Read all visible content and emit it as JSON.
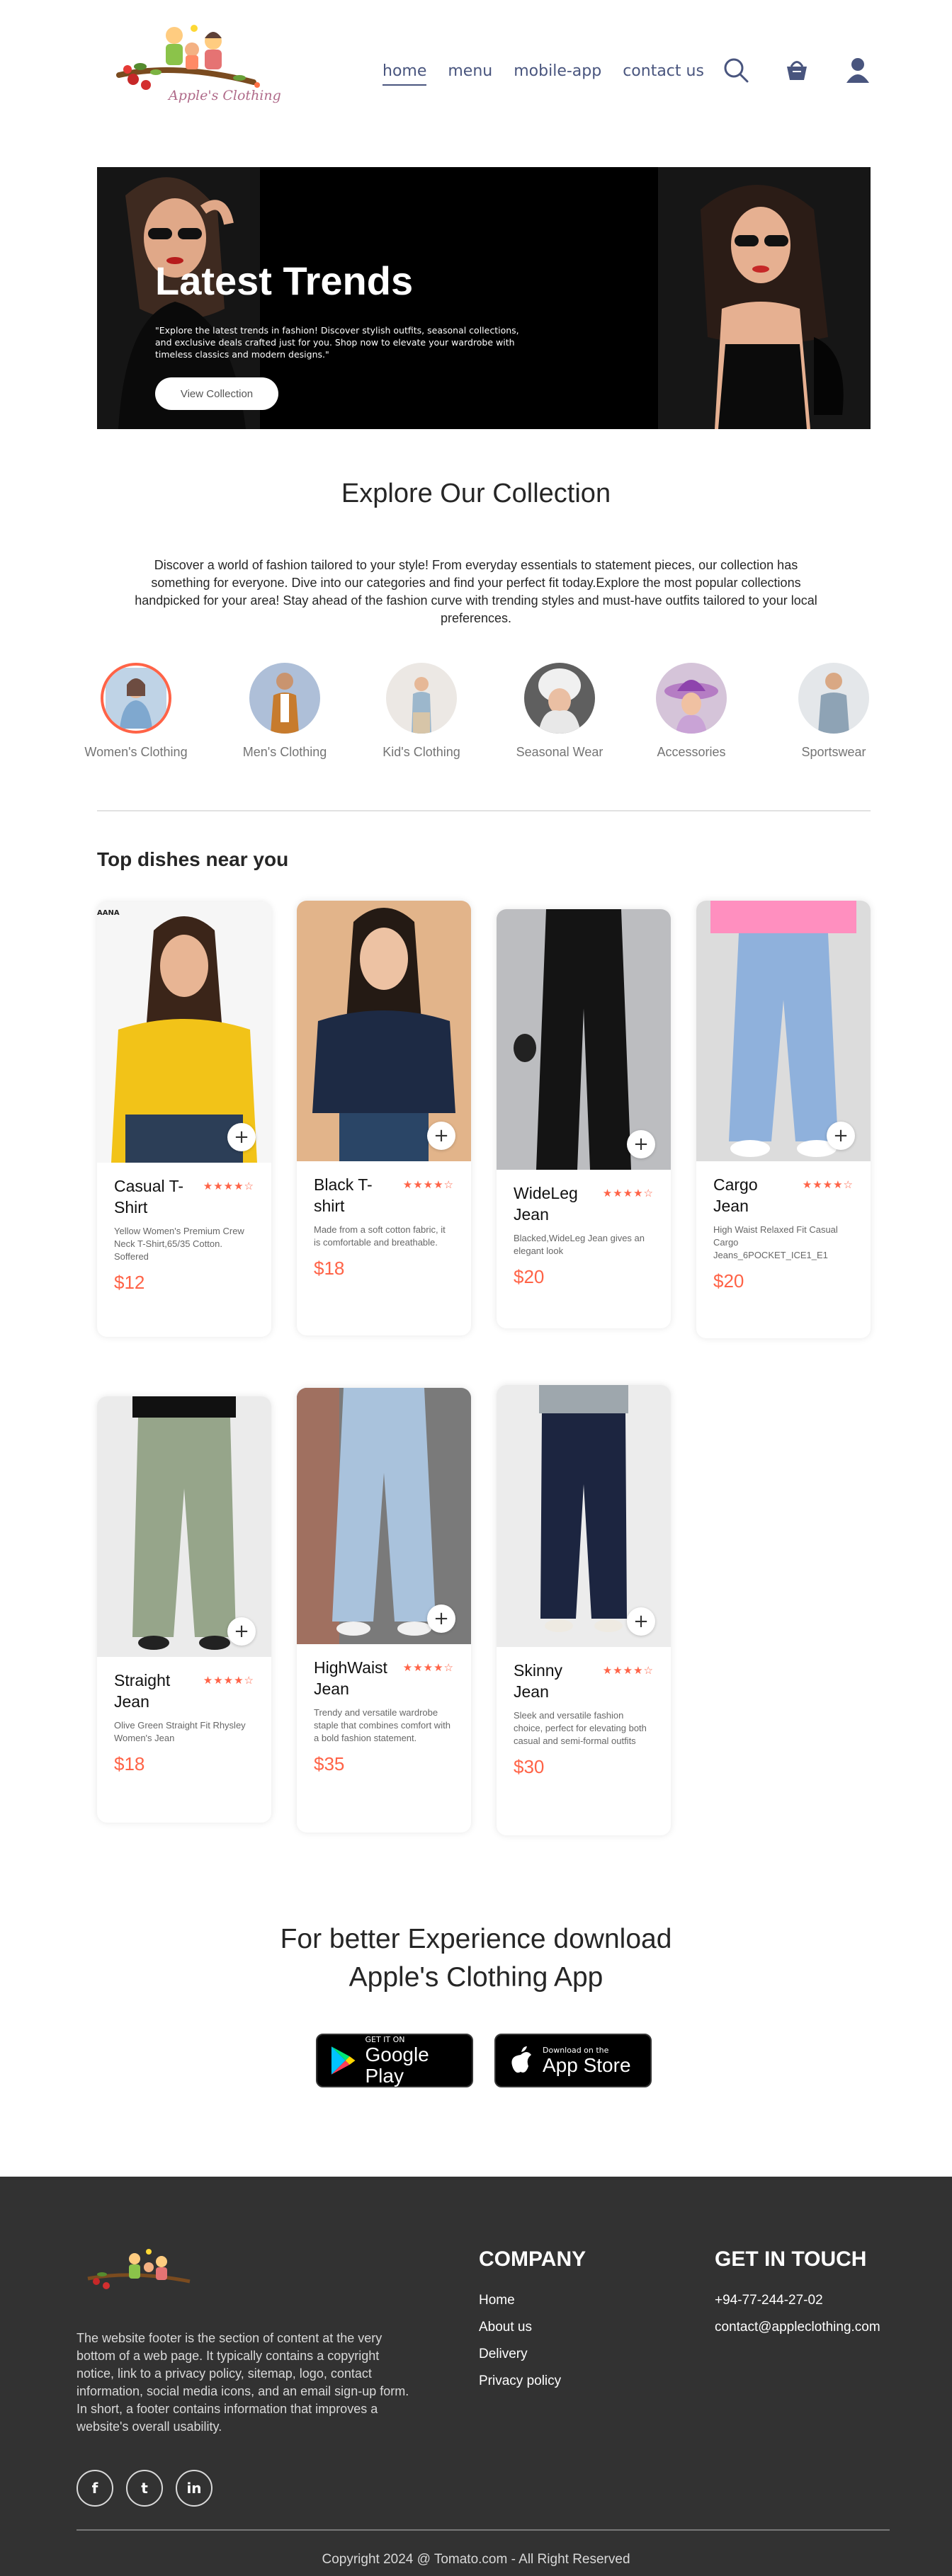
{
  "header": {
    "logo_text": "Apple's Clothing",
    "nav": [
      "home",
      "menu",
      "mobile-app",
      "contact us"
    ],
    "icons": [
      "search-icon",
      "basket-icon",
      "profile-icon"
    ]
  },
  "hero": {
    "title": "Latest Trends",
    "text": "\"Explore the latest trends in fashion! Discover stylish outfits, seasonal collections, and exclusive deals crafted just for you. Shop now to elevate your wardrobe with timeless classics and modern designs.\"",
    "button": "View Collection"
  },
  "explore": {
    "title": "Explore Our Collection",
    "text": "Discover a world of fashion tailored to your style! From everyday essentials to statement pieces, our collection has something for everyone. Dive into our categories and find your perfect fit today.Explore the most popular collections handpicked for your area! Stay ahead of the fashion curve with trending styles and must-have outfits tailored to your local preferences.",
    "categories": [
      "Women's Clothing",
      "Men's Clothing",
      "Kid's Clothing",
      "Seasonal Wear",
      "Accessories",
      "Sportswear"
    ],
    "selected_index": 0
  },
  "products": {
    "title": "Top dishes near you",
    "items": [
      {
        "name": "Casual T-Shirt",
        "desc": "Yellow Women's Premium Crew Neck T-Shirt,65/35 Cotton. Soffered",
        "price": "$12",
        "rating": 4
      },
      {
        "name": "Black T-shirt",
        "desc": "Made from a soft cotton fabric, it is comfortable and breathable.",
        "price": "$18",
        "rating": 4
      },
      {
        "name": "WideLeg Jean",
        "desc": "Blacked,WideLeg Jean gives an elegant look",
        "price": "$20",
        "rating": 4
      },
      {
        "name": "Cargo Jean",
        "desc": "High Waist Relaxed Fit Casual Cargo Jeans_6POCKET_ICE1_E1",
        "price": "$20",
        "rating": 4
      },
      {
        "name": "Straight Jean",
        "desc": "Olive Green Straight Fit Rhysley Women's Jean",
        "price": "$18",
        "rating": 4
      },
      {
        "name": "HighWaist Jean",
        "desc": "Trendy and versatile wardrobe staple that combines comfort with a bold fashion statement.",
        "price": "$35",
        "rating": 4
      },
      {
        "name": "Skinny Jean",
        "desc": "Sleek and versatile fashion choice, perfect for elevating both casual and semi-formal outfits",
        "price": "$30",
        "rating": 4
      }
    ],
    "stars_text": "★★★★☆",
    "add_symbol": "+",
    "first_card_tag": "AANA"
  },
  "app": {
    "title_line1": "For better Experience download",
    "title_line2": "Apple's Clothing App",
    "google_small": "GET IT ON",
    "google_big": "Google Play",
    "apple_small": "Download on the",
    "apple_big": "App Store"
  },
  "footer": {
    "text": "The website footer is the section of content at the very bottom of a web page. It typically contains a copyright notice, link to a privacy policy, sitemap, logo, contact information, social media icons, and an email sign-up form. In short, a footer contains information that improves a website's overall usability.",
    "socials": [
      "f",
      "t",
      "in"
    ],
    "company_title": "COMPANY",
    "company_links": [
      "Home",
      "About us",
      "Delivery",
      "Privacy policy"
    ],
    "contact_title": "GET IN TOUCH",
    "contact": [
      "+94-77-244-27-02",
      "contact@appleclothing.com"
    ],
    "copyright": "Copyright 2024 @ Tomato.com - All Right Reserved"
  },
  "colors": {
    "accent": "#ff6347",
    "nav": "#49557e",
    "footer_bg": "#323232"
  }
}
